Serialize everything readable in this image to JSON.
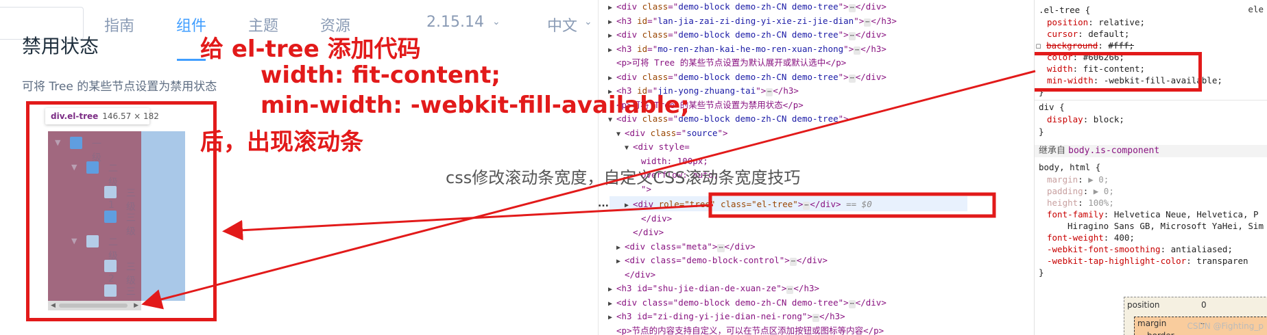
{
  "docs": {
    "nav": {
      "items": [
        "指南",
        "组件",
        "主题",
        "资源"
      ],
      "active_index": 1,
      "version": "2.15.14",
      "language": "中文"
    },
    "section_title": "禁用状态",
    "section_desc": "可将 Tree 的某些节点设置为禁用状态",
    "inspect_tooltip": {
      "tag": "div.el-tree",
      "size": "146.57 × 182"
    },
    "tree_labels": [
      "一级 2",
      "二级 2-1",
      "三级",
      "三级",
      "二级 2-2",
      "三级",
      "三级"
    ]
  },
  "annotation": {
    "line1": "给 el-tree 添加代码",
    "line2": "width: fit-content;",
    "line3": "min-width: -webkit-fill-available;",
    "line4": "后，出现滚动条"
  },
  "overlay_caption": "css修改滚动条宽度，自定义CSS滚动条宽度技巧",
  "elements": {
    "ellipsis": "...",
    "lines": [
      {
        "indent": 0,
        "arrow": "▶",
        "tag": "div",
        "attr": "class",
        "val": "demo-block demo-zh-CN demo-tree",
        "collapsed": true,
        "close": "</div>"
      },
      {
        "indent": 0,
        "arrow": "▶",
        "tag": "h3",
        "attr": "id",
        "val": "lan-jia-zai-zi-ding-yi-xie-zi-jie-dian",
        "collapsed": true,
        "close": "</h3>"
      },
      {
        "indent": 0,
        "arrow": "▶",
        "tag": "div",
        "attr": "class",
        "val": "demo-block demo-zh-CN demo-tree",
        "collapsed": true,
        "close": "</div>"
      },
      {
        "indent": 0,
        "arrow": "▶",
        "tag": "h3",
        "attr": "id",
        "val": "mo-ren-zhan-kai-he-mo-ren-xuan-zhong",
        "collapsed": true,
        "close": "</h3>"
      },
      {
        "indent": 0,
        "arrow": "",
        "text": "<p>可将 Tree 的某些节点设置为默认展开或默认选中</p>"
      },
      {
        "indent": 0,
        "arrow": "▶",
        "tag": "div",
        "attr": "class",
        "val": "demo-block demo-zh-CN demo-tree",
        "collapsed": true,
        "close": "</div>"
      },
      {
        "indent": 0,
        "arrow": "▶",
        "tag": "h3",
        "attr": "id",
        "val": "jin-yong-zhuang-tai",
        "collapsed": true,
        "close": "</h3>"
      },
      {
        "indent": 0,
        "arrow": "",
        "text": "<p>可将 Tree 的某些节点设置为禁用状态</p>"
      },
      {
        "indent": 0,
        "arrow": "▼",
        "tag": "div",
        "attr": "class",
        "val": "demo-block demo-zh-CN demo-tree",
        "collapsed": false,
        "close": ""
      },
      {
        "indent": 1,
        "arrow": "▼",
        "tag": "div",
        "attr": "class",
        "val": "source",
        "collapsed": false,
        "close": ""
      },
      {
        "indent": 2,
        "arrow": "▼",
        "text": "<div style="
      },
      {
        "indent": 3,
        "arrow": "",
        "text": "width: 100px;"
      },
      {
        "indent": 3,
        "arrow": "",
        "text": "overflow: auto;"
      },
      {
        "indent": 3,
        "arrow": "",
        "text": "\">"
      }
    ],
    "selected": {
      "tag": "div",
      "attrs": "role=\"tree\" class=\"el-tree\"",
      "suffix": "== $0"
    },
    "after": [
      {
        "indent": 3,
        "text": "</div>"
      },
      {
        "indent": 2,
        "text": "</div>"
      },
      {
        "indent": 1,
        "arrow": "▶",
        "text": "<div class=\"meta\">",
        "close": "</div>"
      },
      {
        "indent": 1,
        "arrow": "▶",
        "text": "<div class=\"demo-block-control\">",
        "close": "</div>"
      },
      {
        "indent": 1,
        "text": "</div>"
      },
      {
        "indent": 0,
        "arrow": "▶",
        "text": "<h3 id=\"shu-jie-dian-de-xuan-ze\">",
        "close": "</h3>"
      },
      {
        "indent": 0,
        "arrow": "▶",
        "text": "<div class=\"demo-block demo-zh-CN demo-tree\">",
        "close": "</div>"
      },
      {
        "indent": 0,
        "arrow": "▶",
        "text": "<h3 id=\"zi-ding-yi-jie-dian-nei-rong\">",
        "close": "</h3>"
      },
      {
        "indent": 0,
        "arrow": "",
        "text": "<p>节点的内容支持自定义，可以在节点区添加按钮或图标等内容</p>"
      }
    ]
  },
  "styles": {
    "rule1_selector": ".el-tree {",
    "rule1_source": "ele",
    "rule1": [
      {
        "name": "position",
        "value": "relative;"
      },
      {
        "name": "cursor",
        "value": "default;"
      },
      {
        "name": "background",
        "value": "#fff;",
        "struck": true
      },
      {
        "name": "color",
        "value": "#606266;"
      },
      {
        "name": "width",
        "value": "fit-content;"
      },
      {
        "name": "min-width",
        "value": "-webkit-fill-available;"
      }
    ],
    "close": "}",
    "rule2_selector": "div {",
    "rule2": [
      {
        "name": "display",
        "value": "block;"
      }
    ],
    "inherited_label": "继承自",
    "inherited_from": "body.is-component",
    "rule3_selector": "body, html {",
    "rule3": [
      {
        "name": "margin",
        "value": "▶ 0;",
        "inh": true
      },
      {
        "name": "padding",
        "value": "▶ 0;",
        "inh": true
      },
      {
        "name": "height",
        "value": "100%;",
        "inh": true
      },
      {
        "name": "font-family",
        "value": "Helvetica Neue, Helvetica, P"
      },
      {
        "name": "",
        "value": "Hiragino Sans GB, Microsoft YaHei, Sim"
      },
      {
        "name": "font-weight",
        "value": "400;"
      },
      {
        "name": "-webkit-font-smoothing",
        "value": "antialiased;"
      },
      {
        "name": "-webkit-tap-highlight-color",
        "value": "transparen"
      }
    ],
    "box_position": "position",
    "box_position_val": "0",
    "box_margin": "margin",
    "box_margin_val": "–",
    "box_border": "border",
    "watermark": "CSDN @Fighting_p"
  }
}
